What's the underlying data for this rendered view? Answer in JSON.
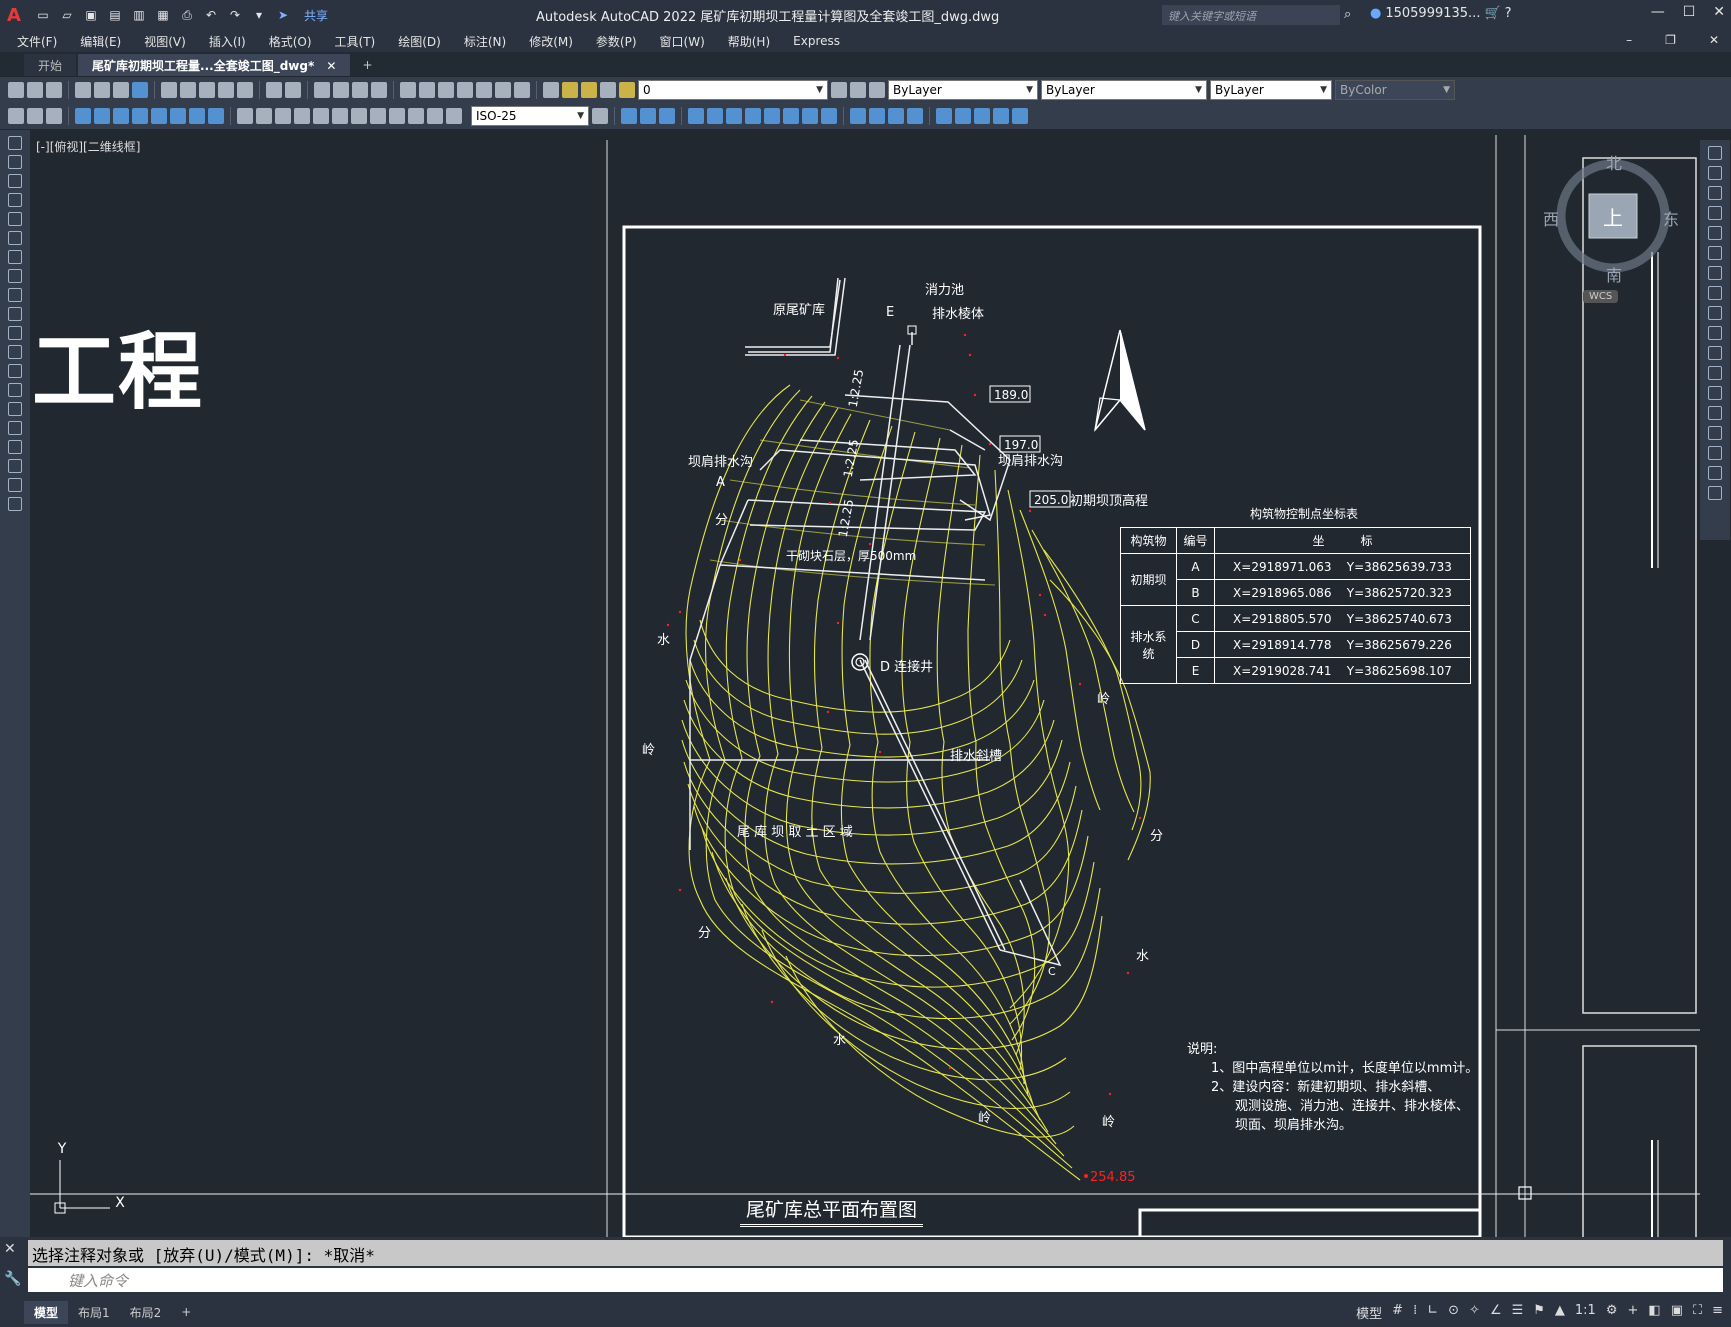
{
  "app": {
    "title": "Autodesk AutoCAD 2022    尾矿库初期坝工程量计算图及全套竣工图_dwg.dwg",
    "logo": "A",
    "share_label": "共享",
    "search_placeholder": "键入关键字或短语",
    "user": "1505999135...",
    "colors": {
      "bg": "#212830",
      "chrome": "#2b3340",
      "contour": "#e6e64a",
      "red": "#ff2020"
    }
  },
  "menu": [
    "文件(F)",
    "编辑(E)",
    "视图(V)",
    "插入(I)",
    "格式(O)",
    "工具(T)",
    "绘图(D)",
    "标注(N)",
    "修改(M)",
    "参数(P)",
    "窗口(W)",
    "帮助(H)",
    "Express"
  ],
  "tabs": [
    {
      "label": "开始"
    },
    {
      "label": "尾矿库初期坝工程量...全套竣工图_dwg*"
    }
  ],
  "toolbar": {
    "layer_value": "0",
    "color_value": "ByLayer",
    "linetype_value": "ByLayer",
    "lineweight_value": "ByLayer",
    "plotstyle_value": "ByColor",
    "dimstyle_value": "ISO-25"
  },
  "canvas": {
    "viewport_label": "[-][俯视][二维线框]",
    "big_text": "工程",
    "viewcube": {
      "north": "北",
      "south": "南",
      "east": "东",
      "west": "西",
      "top": "上",
      "wcs": "WCS"
    },
    "drawing_title": "尾矿库总平面布置图",
    "labels": {
      "yuan": "原尾矿库",
      "xiaoli": "消力池",
      "paishui_lengti": "排水棱体",
      "e_mark": "E",
      "a_mark": "A",
      "b_mark": "B",
      "c_mark": "C",
      "d_lianjie": "D  连接井",
      "bajian_left": "坝肩排水沟",
      "bajian_right": "坝肩排水沟",
      "elev189": "189.0",
      "elev197": "197.0",
      "elev205": "205.0",
      "chuqi": "初期坝顶高程",
      "ganqi": "干砌块石层，厚500mm",
      "xieCao": "排水斜槽",
      "qutu": "尾 库 坝 取 土 区 域",
      "slope1": "1:2.25",
      "slope2": "1:2.25",
      "slope3": "1:2.25",
      "elev_bottom": "254.85",
      "fen1": "分",
      "fen2": "分",
      "fen3": "分",
      "shui1": "水",
      "shui2": "水",
      "shui3": "水",
      "shui4": "水",
      "ling1": "岭",
      "ling2": "岭",
      "ling3": "岭",
      "ling4": "岭"
    },
    "table": {
      "title": "构筑物控制点坐标表",
      "header": [
        "构筑物",
        "编号",
        "坐　　　标"
      ],
      "rows": [
        {
          "group": "初期坝",
          "id": "A",
          "x": "X=2918971.063",
          "y": "Y=38625639.733"
        },
        {
          "group": "",
          "id": "B",
          "x": "X=2918965.086",
          "y": "Y=38625720.323"
        },
        {
          "group": "排水系统",
          "id": "C",
          "x": "X=2918805.570",
          "y": "Y=38625740.673"
        },
        {
          "group": "",
          "id": "D",
          "x": "X=2918914.778",
          "y": "Y=38625679.226"
        },
        {
          "group": "",
          "id": "E",
          "x": "X=2919028.741",
          "y": "Y=38625698.107"
        }
      ]
    },
    "notes": {
      "title": "说明:",
      "line1": "1、图中高程单位以m计，长度单位以mm计。",
      "line2": "2、建设内容：新建初期坝、排水斜槽、",
      "line3": "观测设施、消力池、连接井、排水棱体、",
      "line4": "坝面、坝肩排水沟。"
    }
  },
  "command": {
    "history": "选择注释对象或 [放弃(U)/模式(M)]: *取消*",
    "placeholder": "键入命令"
  },
  "status": {
    "layout_tabs": [
      "模型",
      "布局1",
      "布局2"
    ],
    "model_label": "模型",
    "scale": "1:1"
  }
}
